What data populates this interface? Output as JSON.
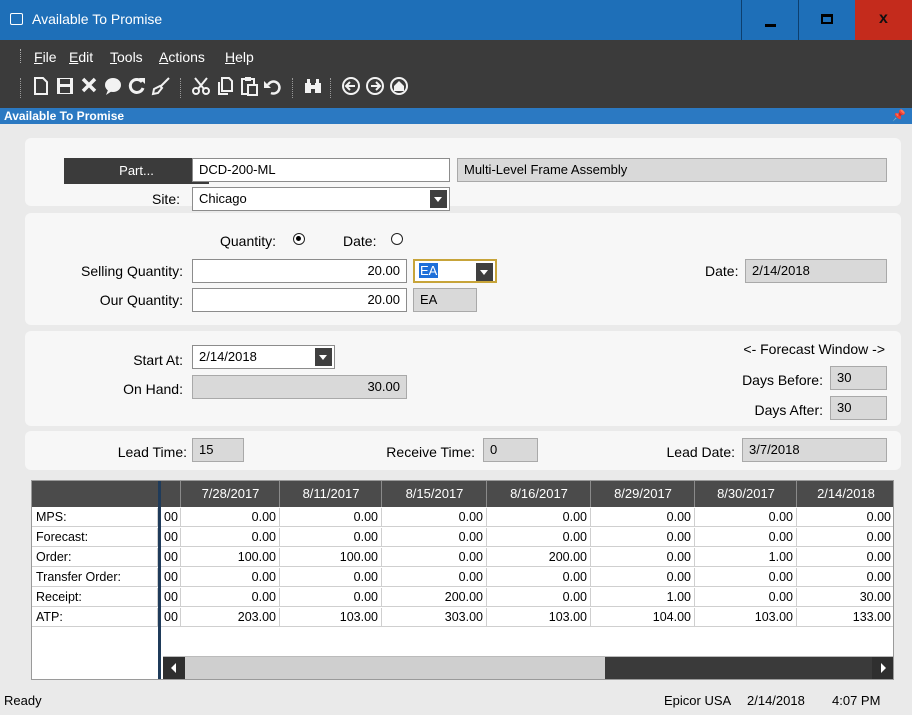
{
  "window": {
    "title": "Available To Promise",
    "controls": {
      "minimize": "minimize",
      "maximize": "maximize",
      "close": "x"
    }
  },
  "menu": {
    "items": [
      {
        "key": "F",
        "rest": "ile"
      },
      {
        "key": "E",
        "rest": "dit"
      },
      {
        "key": "T",
        "rest": "ools"
      },
      {
        "key": "A",
        "rest": "ctions"
      },
      {
        "key": "H",
        "rest": "elp"
      }
    ]
  },
  "toolbar": {
    "icons": [
      "new-icon",
      "save-icon",
      "delete-icon",
      "comment-icon",
      "refresh-icon",
      "clear-icon",
      "cut-icon",
      "copy-icon",
      "paste-icon",
      "undo-icon",
      "search-icon",
      "back-icon",
      "forward-icon",
      "home-icon"
    ]
  },
  "panel": {
    "title": "Available To Promise",
    "pin": "↑"
  },
  "part": {
    "button_label": "Part...",
    "value": "DCD-200-ML",
    "description": "Multi-Level Frame Assembly",
    "site_label": "Site:",
    "site_value": "Chicago"
  },
  "quantity": {
    "quantity_radio_label": "Quantity:",
    "date_radio_label": "Date:",
    "selected": "quantity",
    "selling_label": "Selling Quantity:",
    "selling_value": "20.00",
    "selling_uom": "EA",
    "our_label": "Our Quantity:",
    "our_value": "20.00",
    "our_uom": "EA",
    "date_label": "Date:",
    "date_value": "2/14/2018"
  },
  "forecast": {
    "start_label": "Start At:",
    "start_value": "2/14/2018",
    "onhand_label": "On Hand:",
    "onhand_value": "30.00",
    "window_label": "<- Forecast Window ->",
    "days_before_label": "Days Before:",
    "days_before_value": "30",
    "days_after_label": "Days After:",
    "days_after_value": "30"
  },
  "lead": {
    "lead_time_label": "Lead Time:",
    "lead_time_value": "15",
    "receive_time_label": "Receive Time:",
    "receive_time_value": "0",
    "lead_date_label": "Lead Date:",
    "lead_date_value": "3/7/2018"
  },
  "grid": {
    "columns": [
      "",
      "7/28/2017",
      "8/11/2017",
      "8/15/2017",
      "8/16/2017",
      "8/29/2017",
      "8/30/2017",
      "2/14/2018"
    ],
    "rows": [
      {
        "label": "MPS:",
        "values": [
          "00",
          "0.00",
          "0.00",
          "0.00",
          "0.00",
          "0.00",
          "0.00",
          "0.00"
        ]
      },
      {
        "label": "Forecast:",
        "values": [
          "00",
          "0.00",
          "0.00",
          "0.00",
          "0.00",
          "0.00",
          "0.00",
          "0.00"
        ]
      },
      {
        "label": "Order:",
        "values": [
          "00",
          "100.00",
          "100.00",
          "0.00",
          "200.00",
          "0.00",
          "1.00",
          "0.00"
        ]
      },
      {
        "label": "Transfer Order:",
        "values": [
          "00",
          "0.00",
          "0.00",
          "0.00",
          "0.00",
          "0.00",
          "0.00",
          "0.00"
        ]
      },
      {
        "label": "Receipt:",
        "values": [
          "00",
          "0.00",
          "0.00",
          "200.00",
          "0.00",
          "1.00",
          "0.00",
          "30.00"
        ]
      },
      {
        "label": "ATP:",
        "values": [
          "00",
          "203.00",
          "103.00",
          "303.00",
          "103.00",
          "104.00",
          "103.00",
          "133.00"
        ]
      }
    ]
  },
  "status": {
    "text": "Ready",
    "company": "Epicor USA",
    "date": "2/14/2018",
    "time": "4:07 PM"
  }
}
